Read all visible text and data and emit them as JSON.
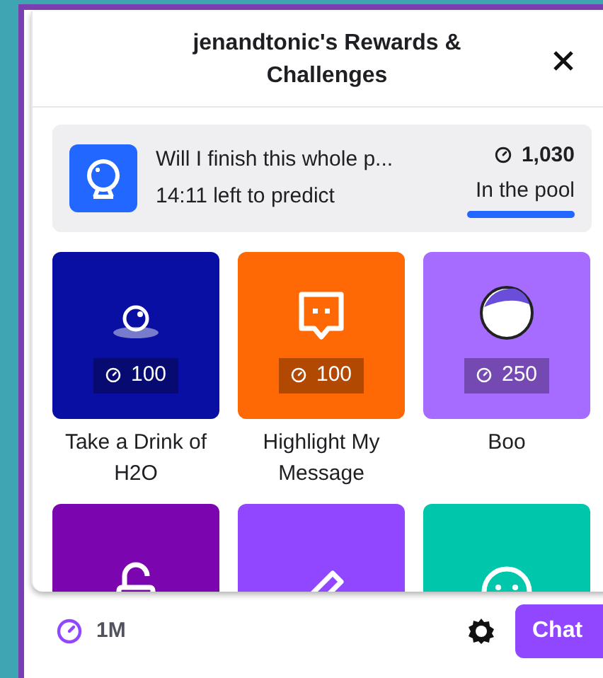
{
  "popup": {
    "title": "jenandtonic's Rewards & Challenges"
  },
  "prediction": {
    "question": "Will I finish this whole p...",
    "time_left": "14:11 left to predict",
    "points": "1,030",
    "pool_label": "In the pool",
    "level": 1
  },
  "rewards": [
    {
      "kind": "drink",
      "color": "#0a0fa3",
      "cost": "100",
      "label": "Take a Drink of H2O"
    },
    {
      "kind": "message",
      "color": "#ff6905",
      "cost": "100",
      "label": "Highlight My Message"
    },
    {
      "kind": "emote",
      "color": "#a66bff",
      "cost": "250",
      "label": "Boo"
    },
    {
      "kind": "unlock",
      "color": "#7b06b0"
    },
    {
      "kind": "pencil",
      "color": "#9147ff"
    },
    {
      "kind": "face",
      "color": "#00c7ac"
    }
  ],
  "footer": {
    "balance": "1M",
    "chat_button": "Chat"
  }
}
